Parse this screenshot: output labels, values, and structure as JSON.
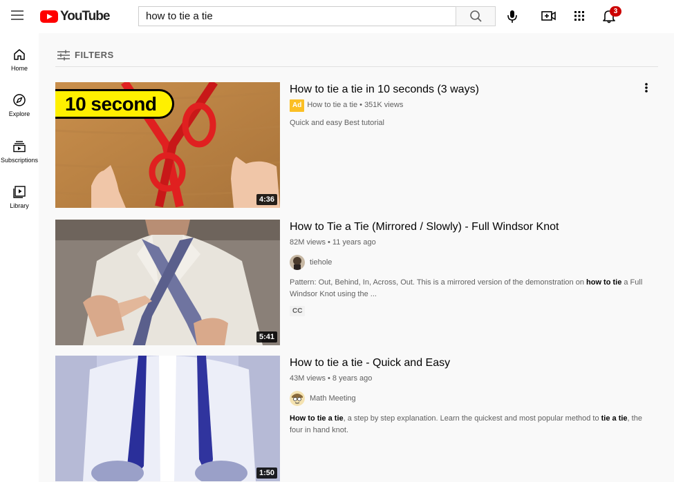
{
  "colors": {
    "brand_red": "#ff0000",
    "badge_red": "#cc0000",
    "ad_yellow": "#fbbf24"
  },
  "header": {
    "logo_text": "YouTube",
    "search_value": "how to tie a tie",
    "notification_count": "3"
  },
  "sidebar": {
    "items": [
      {
        "label": "Home",
        "icon": "home-icon"
      },
      {
        "label": "Explore",
        "icon": "compass-icon"
      },
      {
        "label": "Subscriptions",
        "icon": "subscriptions-icon"
      },
      {
        "label": "Library",
        "icon": "library-icon"
      }
    ]
  },
  "filters": {
    "label": "FILTERS"
  },
  "results": [
    {
      "title": "How to tie a tie in 10 seconds (3 ways)",
      "ad_label": "Ad",
      "meta": "How to tie a tie • 351K views",
      "description": "Quick and easy Best tutorial",
      "duration": "4:36",
      "thumb_text": "10 second"
    },
    {
      "title": "How to Tie a Tie (Mirrored / Slowly) - Full Windsor Knot",
      "meta": "82M views • 11 years ago",
      "channel": "tiehole",
      "description_parts": [
        "Pattern: Out, Behind, In, Across, Out. This is a mirrored version of the demonstration on ",
        "how to tie",
        " a Full Windsor Knot using the ..."
      ],
      "cc_label": "CC",
      "duration": "5:41"
    },
    {
      "title": "How to tie a tie - Quick and Easy",
      "meta": "43M views • 8 years ago",
      "channel": "Math Meeting",
      "description_parts": [
        "How to tie a tie",
        ", a step by step explanation. Learn the quickest and most popular method to ",
        "tie a tie",
        ", the four in hand knot."
      ],
      "duration": "1:50"
    }
  ]
}
